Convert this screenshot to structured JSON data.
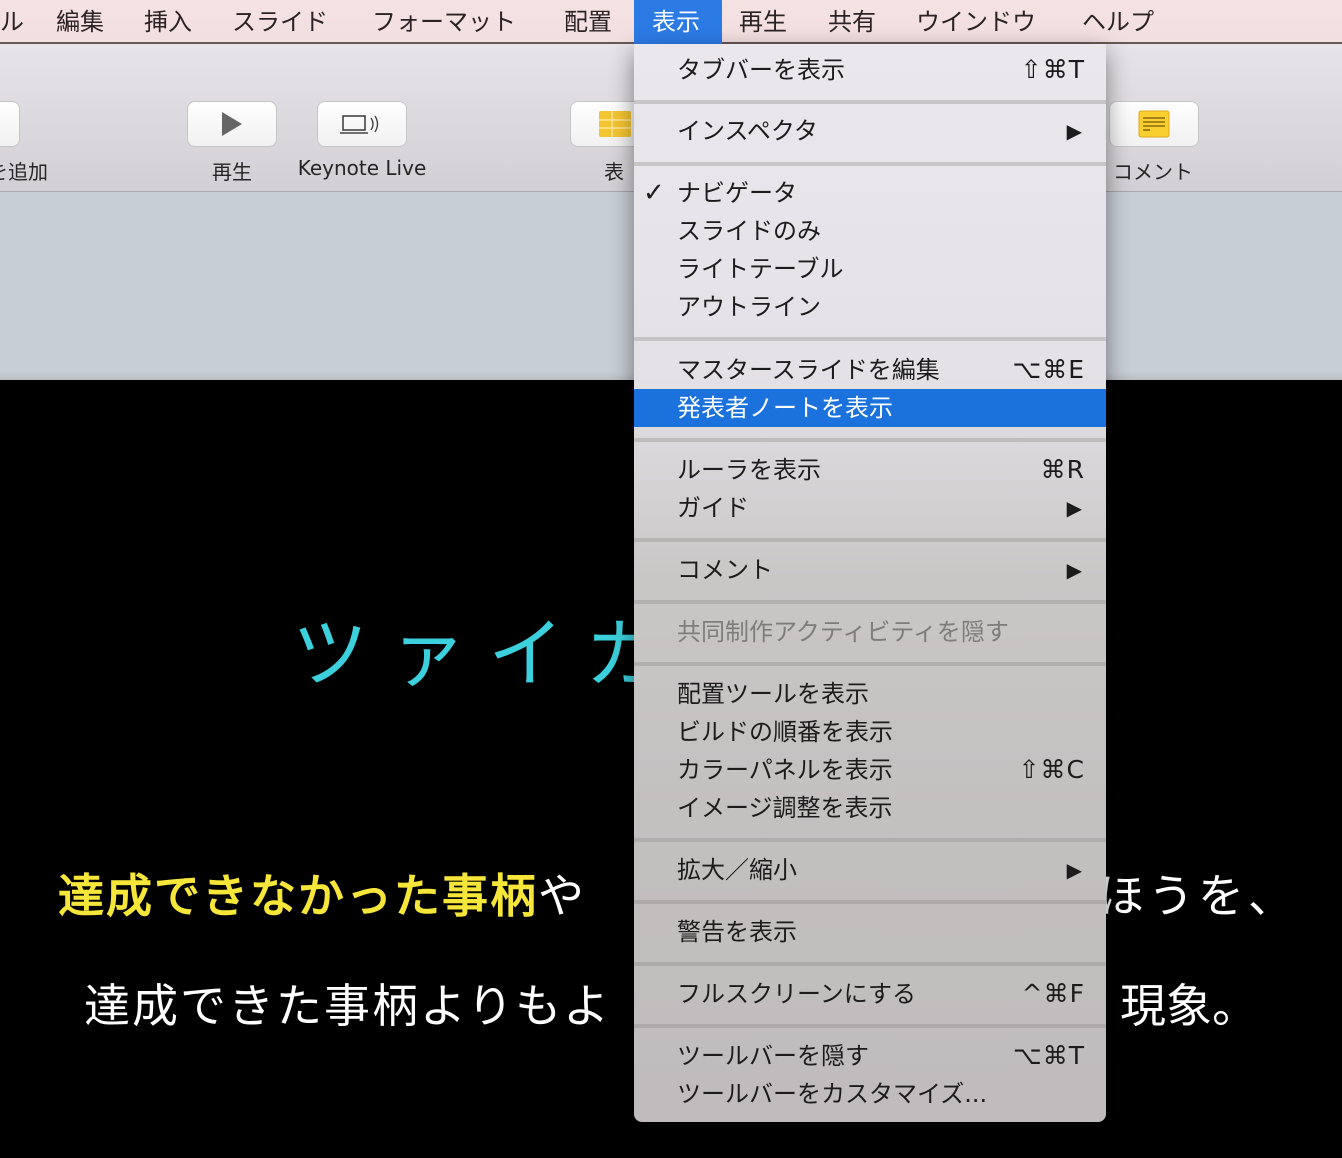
{
  "menubar": {
    "items": [
      {
        "label": "ル"
      },
      {
        "label": "編集"
      },
      {
        "label": "挿入"
      },
      {
        "label": "スライド"
      },
      {
        "label": "フォーマット"
      },
      {
        "label": "配置"
      },
      {
        "label": "表示",
        "active": true
      },
      {
        "label": "再生"
      },
      {
        "label": "共有"
      },
      {
        "label": "ウインドウ"
      },
      {
        "label": "ヘルプ"
      }
    ]
  },
  "toolbar": {
    "add_slide_label": "を追加",
    "play_label": "再生",
    "keynote_live_label": "Keynote Live",
    "table_label": "表",
    "comment_label": "コメント"
  },
  "slide": {
    "title": "ツァイガ",
    "line1_highlight": "達成できなかった事柄",
    "line1_normal": "や",
    "line1_tail": "ほうを、",
    "line2": "達成できた事柄よりもよ",
    "line2_tail": "現象。",
    "colors": {
      "title": "#3ccfdc",
      "highlight": "#f6e63a",
      "text": "#ffffff",
      "background": "#000000"
    }
  },
  "view_menu": {
    "title": "表示",
    "items": [
      {
        "label": "タブバーを表示",
        "shortcut": "⇧⌘T"
      },
      {
        "label": "インスペクタ",
        "submenu": true
      },
      {
        "label": "ナビゲータ",
        "checked": true
      },
      {
        "label": "スライドのみ"
      },
      {
        "label": "ライトテーブル"
      },
      {
        "label": "アウトライン"
      },
      {
        "label": "マスタースライドを編集",
        "shortcut": "⌥⌘E"
      },
      {
        "label": "発表者ノートを表示",
        "highlighted": true
      },
      {
        "label": "ルーラを表示",
        "shortcut": "⌘R"
      },
      {
        "label": "ガイド",
        "submenu": true
      },
      {
        "label": "コメント",
        "submenu": true
      },
      {
        "label": "共同制作アクティビティを隠す",
        "disabled": true
      },
      {
        "label": "配置ツールを表示"
      },
      {
        "label": "ビルドの順番を表示"
      },
      {
        "label": "カラーパネルを表示",
        "shortcut": "⇧⌘C"
      },
      {
        "label": "イメージ調整を表示"
      },
      {
        "label": "拡大／縮小",
        "submenu": true
      },
      {
        "label": "警告を表示"
      },
      {
        "label": "フルスクリーンにする",
        "shortcut": "^⌘F"
      },
      {
        "label": "ツールバーを隠す",
        "shortcut": "⌥⌘T"
      },
      {
        "label": "ツールバーをカスタマイズ..."
      }
    ],
    "check_glyph": "✓",
    "submenu_glyph": "▶",
    "highlight_color": "#1b72dc"
  }
}
